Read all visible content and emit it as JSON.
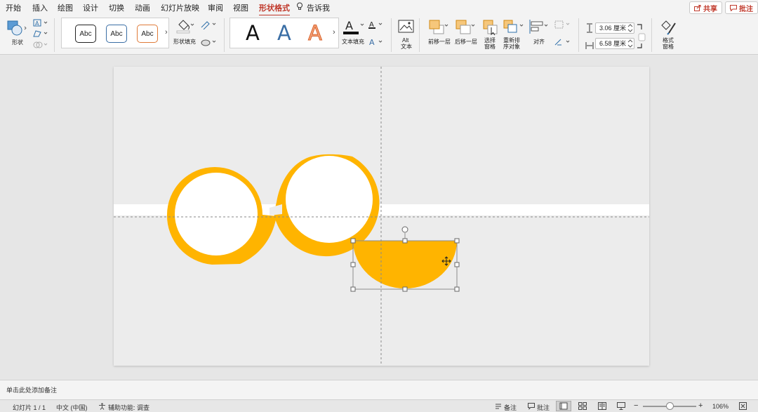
{
  "tabs": [
    "开始",
    "插入",
    "绘图",
    "设计",
    "切换",
    "动画",
    "幻灯片放映",
    "审阅",
    "视图",
    "形状格式",
    "告诉我"
  ],
  "active_tab": "形状格式",
  "share_label": "共享",
  "comment_label": "批注",
  "ribbon": {
    "shape_label": "形状",
    "style_samples": [
      "Abc",
      "Abc",
      "Abc"
    ],
    "shape_fill_label": "形状填充",
    "wordart_sample": "A",
    "text_fill_label": "文本填充",
    "alt_text_label_1": "Alt",
    "alt_text_label_2": "文本",
    "bring_forward_label": "前移一层",
    "send_backward_label": "后移一层",
    "selection_pane_label_1": "选择",
    "selection_pane_label_2": "窗格",
    "reorder_label_1": "重新排",
    "reorder_label_2": "序对象",
    "align_label": "对齐",
    "height_value": "3.06 厘米",
    "width_value": "6.58 厘米",
    "format_pane_label_1": "格式",
    "format_pane_label_2": "窗格"
  },
  "notes_placeholder": "单击此处添加备注",
  "status": {
    "slide_counter": "幻灯片 1 / 1",
    "language": "中文 (中国)",
    "accessibility": "辅助功能: 调查",
    "notes_btn": "备注",
    "comments_btn": "批注",
    "zoom": "106%"
  },
  "colors": {
    "accent_orange": "#ffb400",
    "active_tab_red": "#c0392b",
    "slide_bg": "#ececec"
  }
}
